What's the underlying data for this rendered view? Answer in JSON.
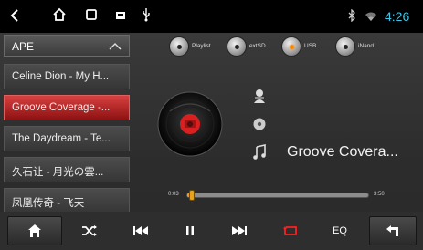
{
  "status_bar": {
    "time": "4:26",
    "icons": [
      "back-icon",
      "home-icon",
      "recent-apps-icon",
      "screenshot-icon",
      "usb-icon",
      "bluetooth-icon",
      "wifi-icon"
    ]
  },
  "playlist": {
    "header": "APE",
    "items": [
      {
        "label": "Celine Dion - My H..."
      },
      {
        "label": "Groove Coverage -..."
      },
      {
        "label": "The Daydream - Te..."
      },
      {
        "label": "久石让 - 月光の雲..."
      },
      {
        "label": "凤凰传奇 - 飞天"
      }
    ],
    "selected_index": 1
  },
  "sources": [
    {
      "label": "Playlist",
      "active": false
    },
    {
      "label": "extSD",
      "active": false
    },
    {
      "label": "USB",
      "active": true
    },
    {
      "label": "iNand",
      "active": false
    }
  ],
  "now_playing": {
    "title": "Groove Covera...",
    "elapsed": "0:03",
    "duration": "3:50",
    "progress": 0.013
  },
  "controls": {
    "eq_label": "EQ",
    "buttons": [
      "home-icon",
      "shuffle-icon",
      "previous-icon",
      "pause-icon",
      "next-icon",
      "repeat-icon",
      "eq-button",
      "back-icon"
    ]
  },
  "colors": {
    "accent_red": "#d83a3a",
    "progress_orange": "#e9a21c",
    "time_cyan": "#3fc6e6",
    "repeat_red": "#ff2020"
  }
}
